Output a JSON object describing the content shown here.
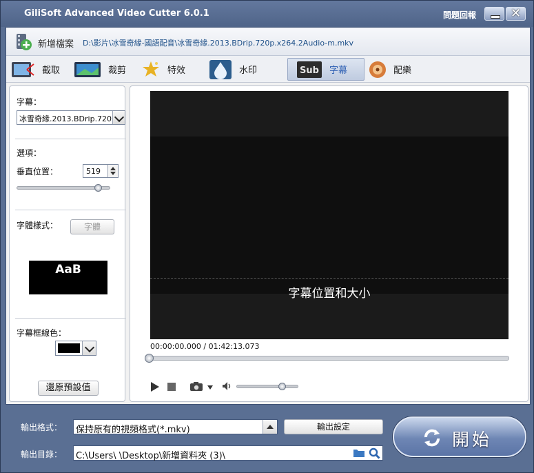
{
  "window": {
    "title": "GiliSoft Advanced Video Cutter 6.0.1",
    "feedback_label": "問題回報",
    "minimize_icon": "minimize-icon",
    "close_icon": "close-icon"
  },
  "filebar": {
    "add_label": "新增檔案",
    "file_path": "D:\\影片\\冰雪奇緣-國語配音\\冰雪奇緣.2013.BDrip.720p.x264.2Audio-m.mkv"
  },
  "toolbar": {
    "items": [
      {
        "label": "截取",
        "icon": "film-cut-icon",
        "active": false
      },
      {
        "label": "裁剪",
        "icon": "crop-icon",
        "active": false
      },
      {
        "label": "特效",
        "icon": "effects-icon",
        "active": false
      },
      {
        "label": "水印",
        "icon": "watermark-icon",
        "active": false
      },
      {
        "label": "字幕",
        "icon": "subtitle-icon",
        "active": true
      },
      {
        "label": "配樂",
        "icon": "music-icon",
        "active": false
      }
    ]
  },
  "left_panel": {
    "subtitle_label": "字幕：",
    "subtitle_file": "冰雪奇緣.2013.BDrip.720p",
    "options_label": "選項：",
    "vertical_pos_label": "垂直位置：",
    "vertical_pos_value": "519",
    "vertical_slider_fraction": 0.88,
    "font_style_label": "字體樣式：",
    "font_button": "字體",
    "preview_text": "AaB",
    "border_color_label": "字幕框線色：",
    "border_color": "#000000",
    "reset_button": "還原預設值"
  },
  "player": {
    "subtitle_overlay": "字幕位置和大小",
    "current_time": "00:00:00.000",
    "total_time": "01:42:13.073",
    "time_separator": " / ",
    "progress_fraction": 0.0,
    "volume_fraction": 0.75
  },
  "bottom": {
    "output_format_label": "輸出格式：",
    "output_format_value": "保持原有的視頻格式(*.mkv)",
    "output_settings_button": "輸出設定",
    "output_dir_label": "輸出目錄：",
    "output_dir_value": "C:\\Users\\            \\Desktop\\新增資料夾 (3)\\",
    "start_button": "開始"
  },
  "colors": {
    "frame": "#5a6f93",
    "panel_bg": "#f2f2f2",
    "accent": "#6e86b4"
  }
}
